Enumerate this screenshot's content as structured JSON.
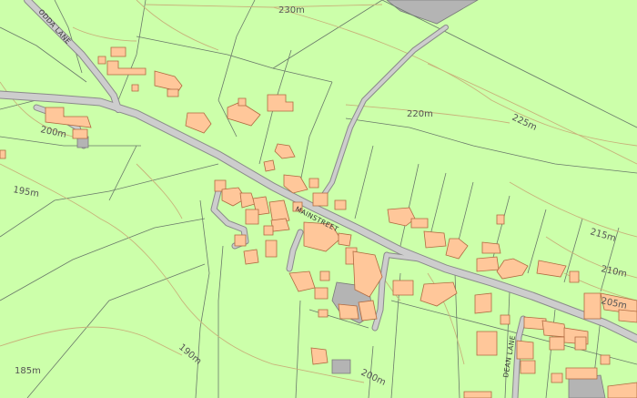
{
  "map": {
    "contour_labels": {
      "c230": "230m",
      "c225": "225m",
      "c220": "220m",
      "c215": "215m",
      "c210": "210m",
      "c205": "205m",
      "c200": "200m",
      "c200b": "200m",
      "c195": "195m",
      "c190": "190m",
      "c185": "185m"
    },
    "road_labels": {
      "odda_lane": "ODDA LANE",
      "main_street": "MAINSTREET",
      "dean_lane": "DEAN LANE"
    },
    "colors": {
      "land": "#ccffaa",
      "building": "#ffc79a",
      "road": "#cdcdcd",
      "contour": "#c8b27a",
      "boundary": "#6a7a6a"
    }
  }
}
